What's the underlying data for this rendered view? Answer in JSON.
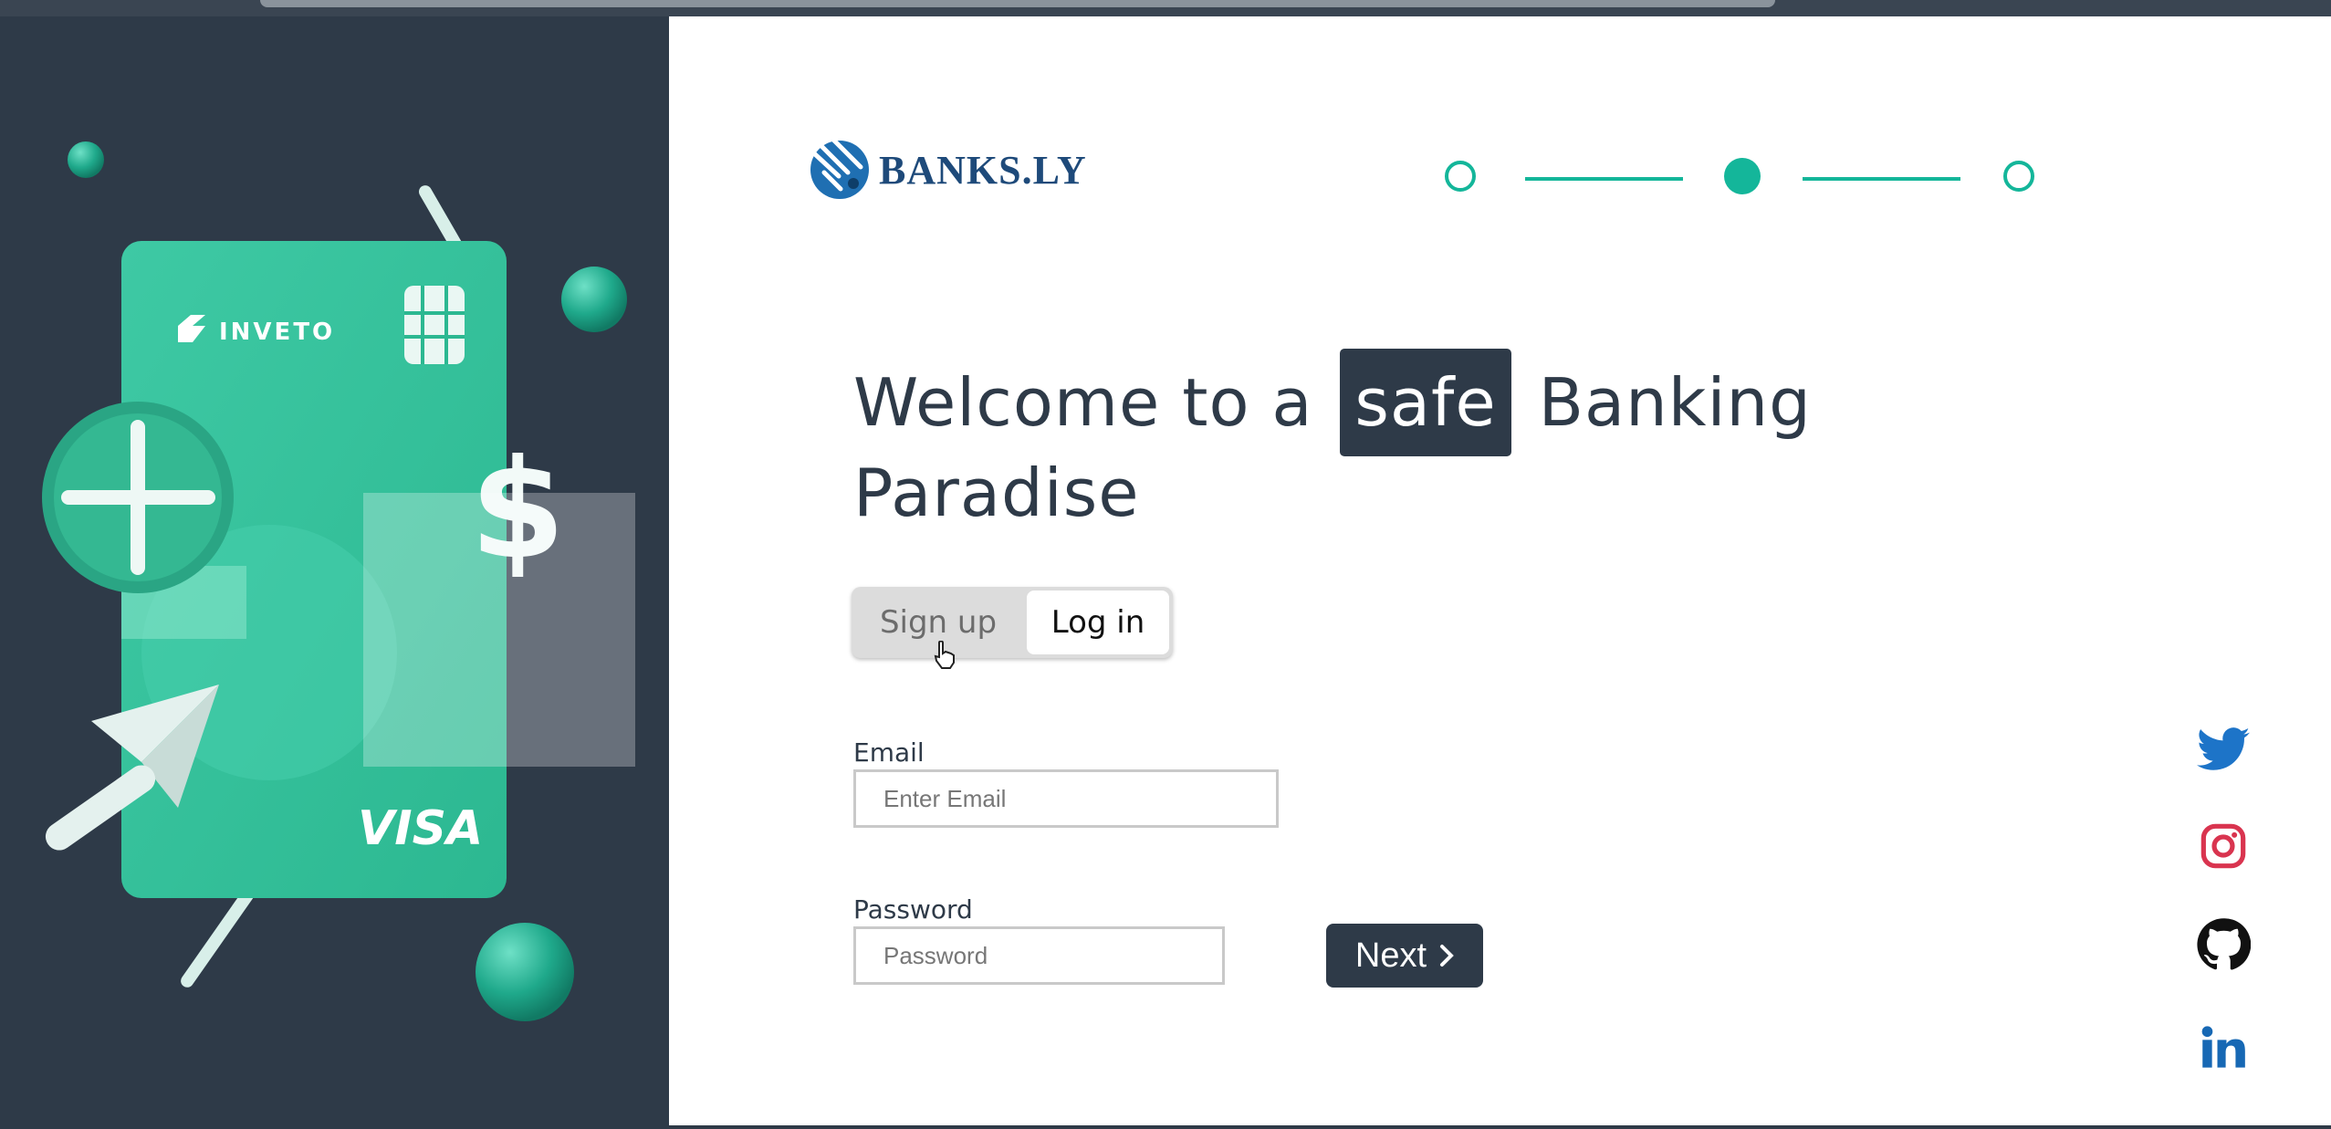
{
  "brand": {
    "name": "BANKS.LY"
  },
  "card": {
    "brand": "INVETO",
    "network": "VISA",
    "currency_symbol": "$"
  },
  "stepper": {
    "total_steps": 3,
    "current_step": 2
  },
  "heading": {
    "before": "Welcome to a",
    "highlight": "safe",
    "after": "Banking Paradise"
  },
  "auth_toggle": {
    "signup_label": "Sign up",
    "login_label": "Log in",
    "active": "Log in"
  },
  "form": {
    "email_label": "Email",
    "email_placeholder": "Enter Email",
    "email_value": "",
    "password_label": "Password",
    "password_placeholder": "Password",
    "password_value": "",
    "next_label": "Next"
  },
  "social": [
    {
      "icon": "twitter-icon",
      "color": "#1d74c8"
    },
    {
      "icon": "instagram-icon",
      "color": "#d9344f"
    },
    {
      "icon": "github-icon",
      "color": "#111111"
    },
    {
      "icon": "linkedin-icon",
      "color": "#1768b4"
    }
  ],
  "colors": {
    "accent": "#14b69a",
    "dark": "#2e3a48",
    "brand_blue": "#1e4a7a"
  }
}
